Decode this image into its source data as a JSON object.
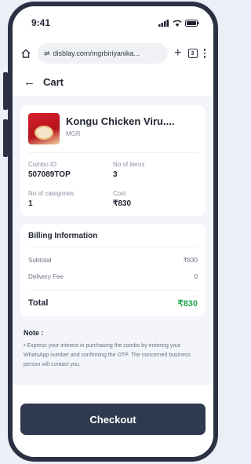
{
  "status_bar": {
    "time": "9:41"
  },
  "browser": {
    "url": "disblay.com/mgrbiriyanika...",
    "tab_count": "3",
    "icons": [
      "home-icon",
      "site-settings-icon",
      "new-tab-icon",
      "tabs-icon",
      "menu-icon"
    ]
  },
  "header": {
    "title": "Cart"
  },
  "product": {
    "name": "Kongu Chicken Viru....",
    "brand": "MGR",
    "combo_id_label": "Combo ID",
    "combo_id": "507089TOP",
    "items_label": "No of items",
    "items": "3",
    "categories_label": "No of categories",
    "categories": "1",
    "cost_label": "Cost",
    "cost": "₹830"
  },
  "billing": {
    "title": "Billing Information",
    "subtotal_label": "Subtotal",
    "subtotal": "₹830",
    "delivery_label": "Delivery Fee",
    "delivery": "0",
    "total_label": "Total",
    "total": "₹830"
  },
  "note": {
    "title": "Note :",
    "body": "• Express your interest in purchasing the combo by entering your WhatsApp number and confirming the OTP. The concerned business person will contact you."
  },
  "checkout": {
    "label": "Checkout"
  },
  "colors": {
    "accent": "#2f3a4e",
    "total_green": "#22a34a"
  }
}
